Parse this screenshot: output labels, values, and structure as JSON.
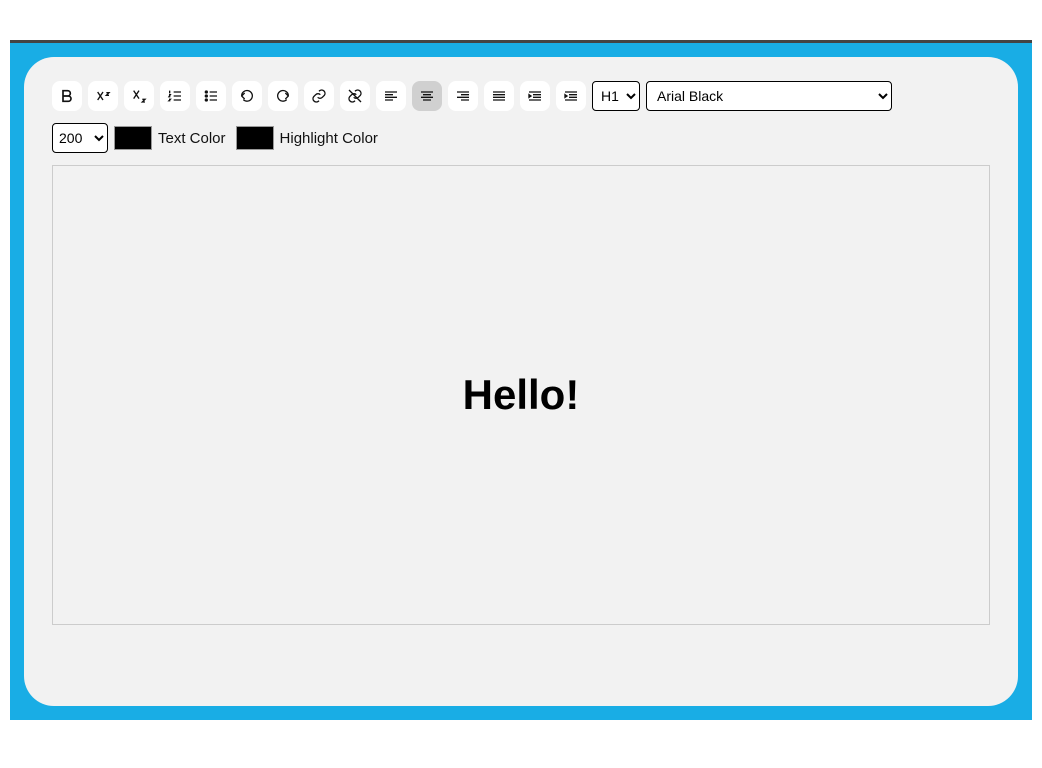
{
  "toolbar": {
    "heading_value": "H1",
    "font_value": "Arial Black",
    "size_value": "200",
    "text_color_label": "Text Color",
    "highlight_color_label": "Highlight Color",
    "text_color": "#000000",
    "highlight_color": "#000000"
  },
  "icons": {
    "bold": "bold",
    "superscript": "superscript",
    "subscript": "subscript",
    "ordered_list": "ordered-list",
    "unordered_list": "unordered-list",
    "undo": "undo",
    "redo": "redo",
    "link": "link",
    "unlink": "unlink",
    "align_left": "align-left",
    "align_center": "align-center",
    "align_right": "align-right",
    "align_justify": "align-justify",
    "outdent": "outdent",
    "indent": "indent"
  },
  "editor": {
    "content": "Hello!"
  }
}
